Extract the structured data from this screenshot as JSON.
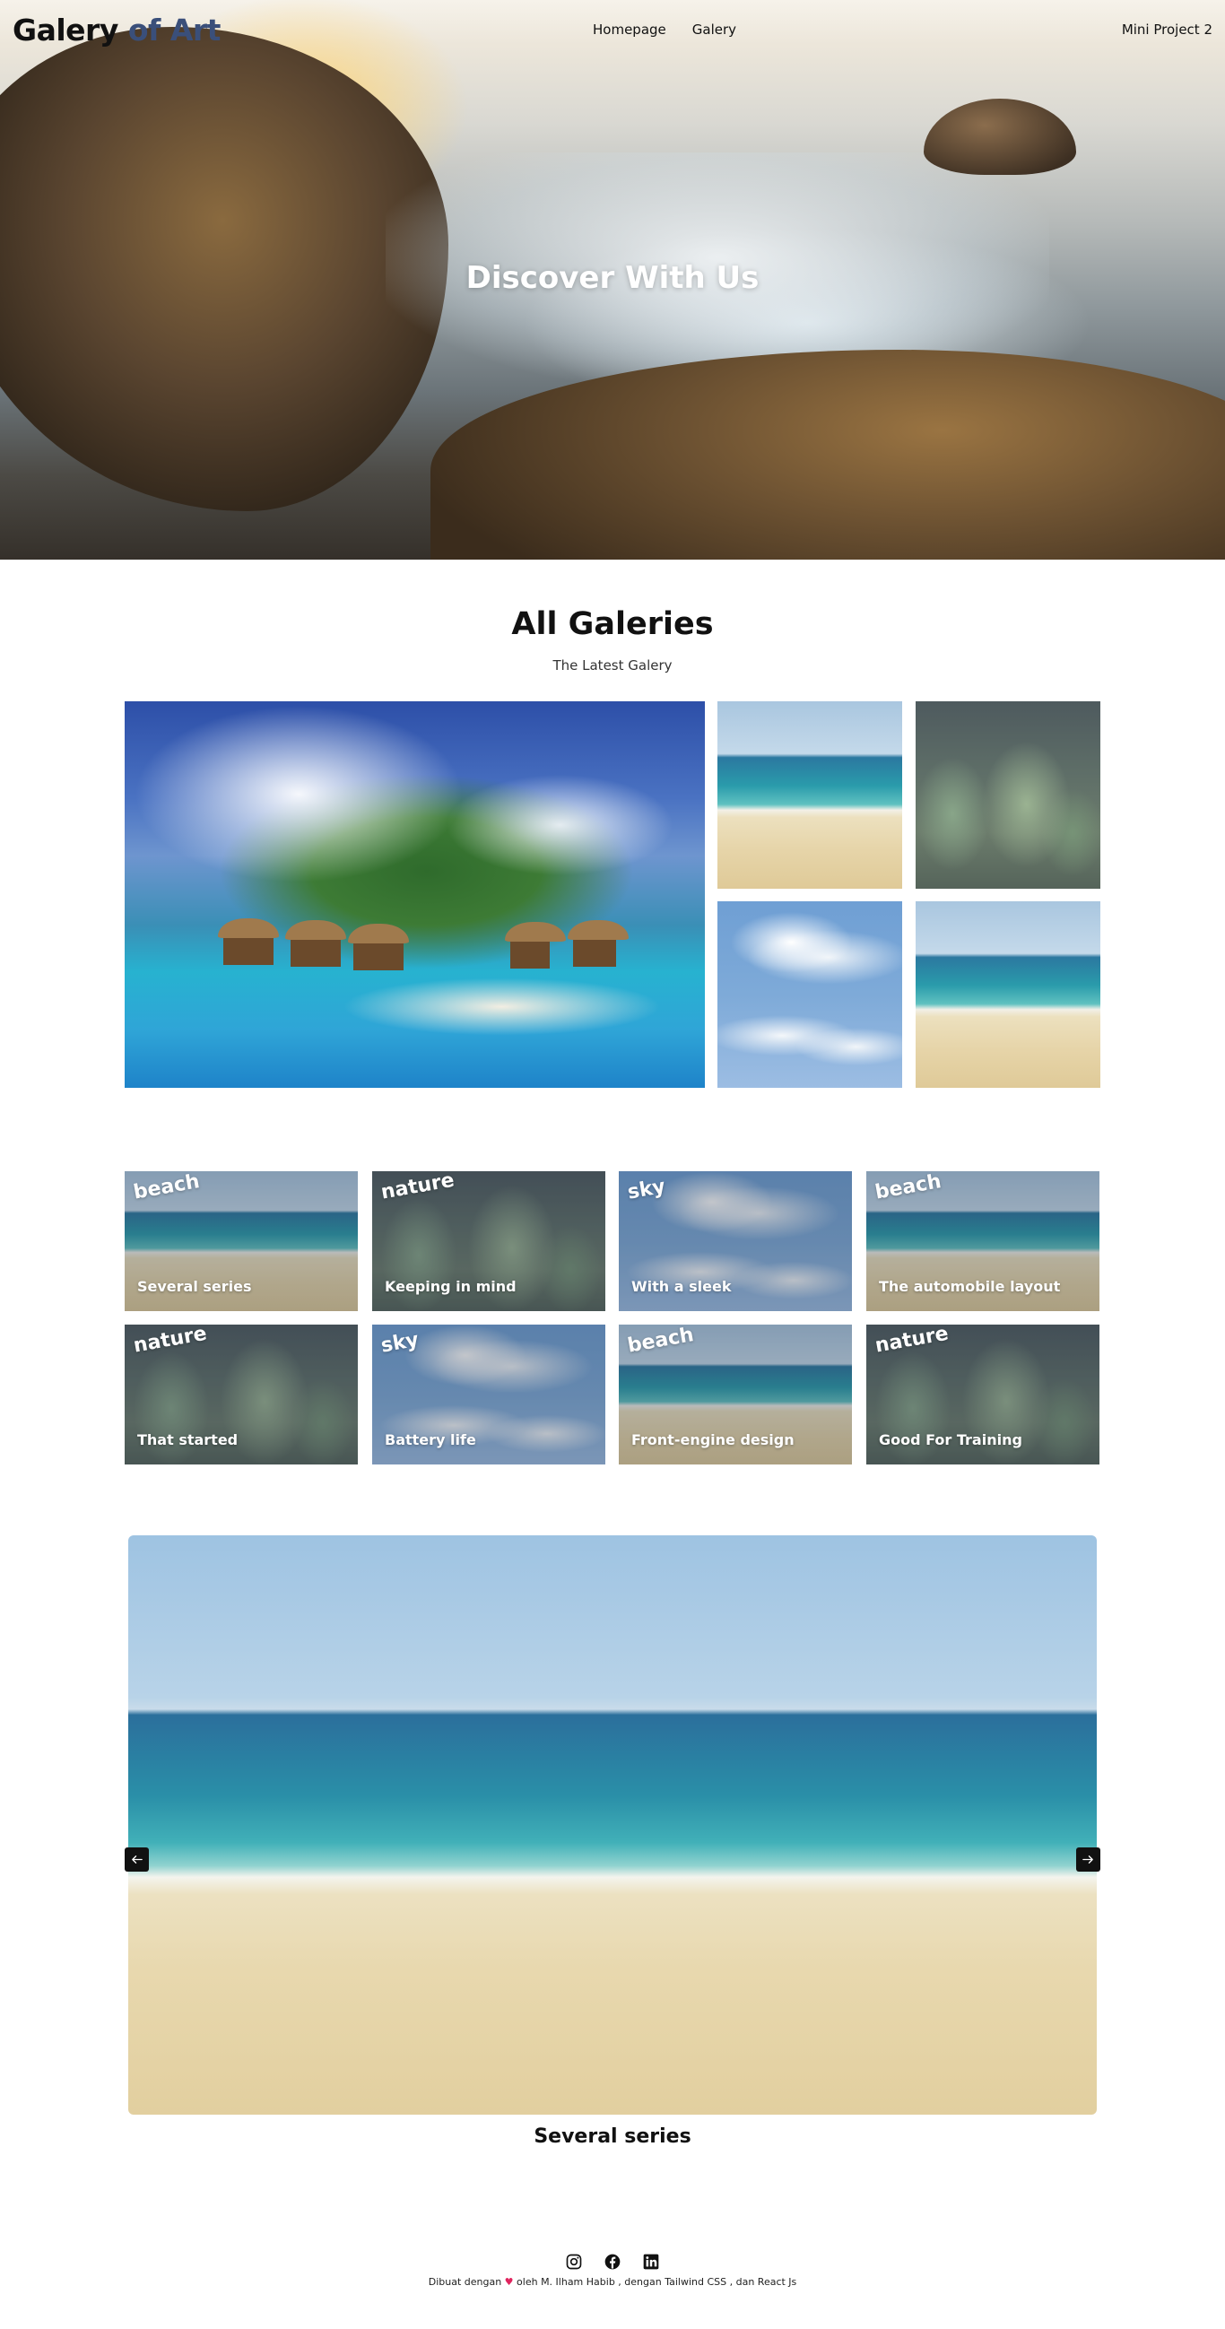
{
  "nav": {
    "brand_part1": "Galery ",
    "brand_part2": "of Art",
    "links": [
      "Homepage",
      "Galery"
    ],
    "right": "Mini Project 2"
  },
  "hero": {
    "title": "Discover With Us"
  },
  "gallery": {
    "title": "All Galeries",
    "subtitle": "The Latest Galery"
  },
  "cards": [
    {
      "tag": "beach",
      "title": "Several series"
    },
    {
      "tag": "nature",
      "title": "Keeping in mind"
    },
    {
      "tag": "sky",
      "title": "With a sleek"
    },
    {
      "tag": "beach",
      "title": "The automobile layout"
    },
    {
      "tag": "nature",
      "title": "That started"
    },
    {
      "tag": "sky",
      "title": "Battery life"
    },
    {
      "tag": "beach",
      "title": "Front-engine design"
    },
    {
      "tag": "nature",
      "title": "Good For Training"
    }
  ],
  "carousel": {
    "caption": "Several series",
    "prev_icon": "arrow-left-icon",
    "next_icon": "arrow-right-icon"
  },
  "footer": {
    "icons": [
      "instagram-icon",
      "facebook-icon",
      "linkedin-icon"
    ],
    "text_before": "Dibuat dengan ",
    "heart": "♥",
    "text_after": " oleh M. Ilham Habib , dengan Tailwind CSS , dan React Js"
  }
}
